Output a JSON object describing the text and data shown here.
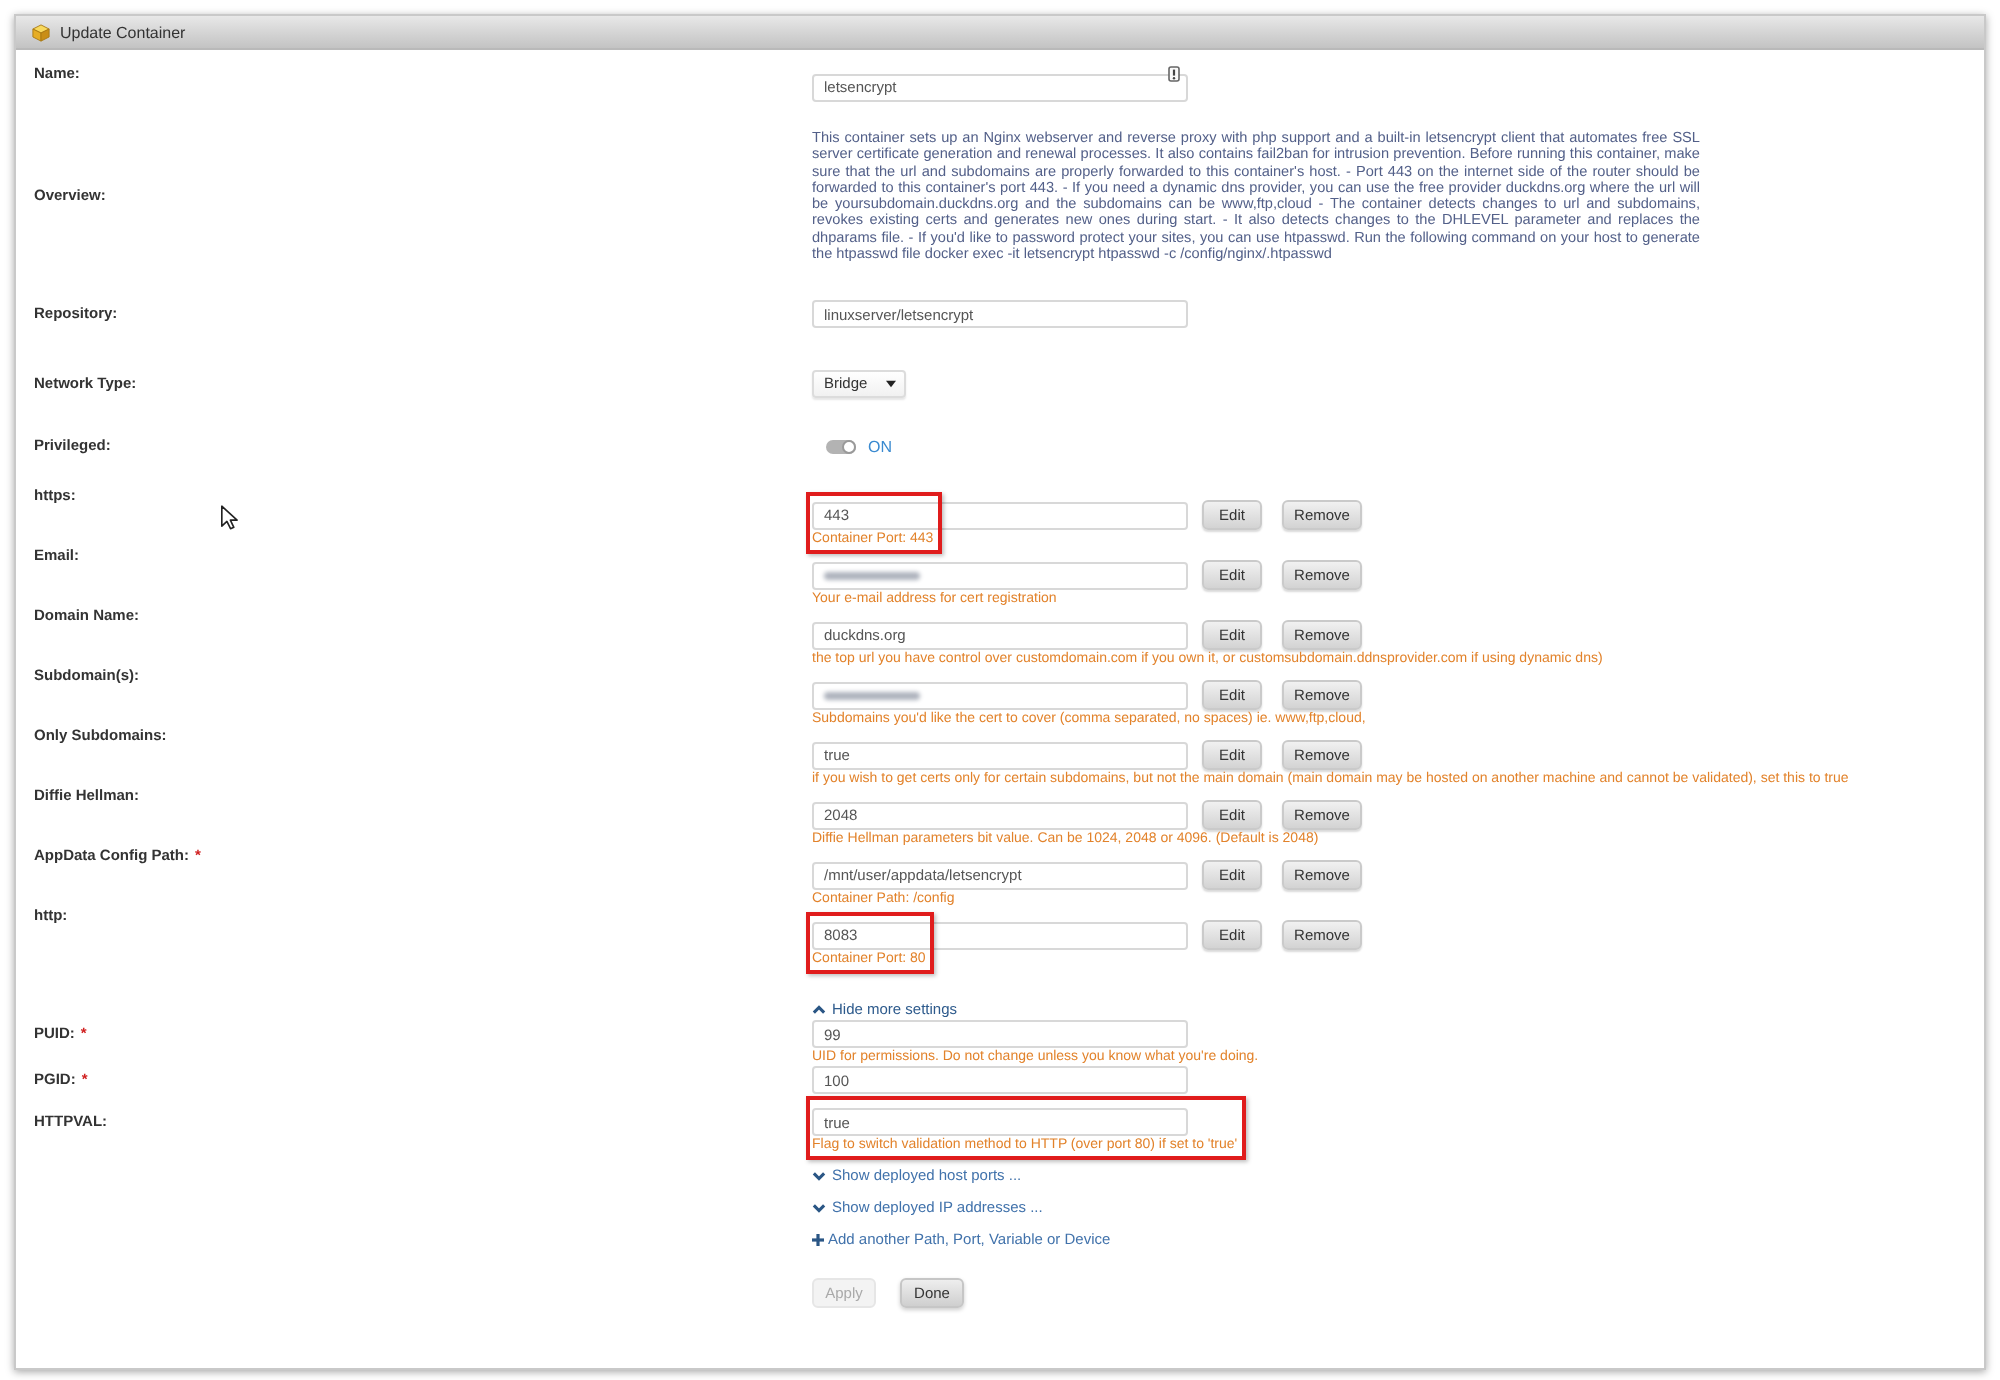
{
  "panel": {
    "title": "Update Container"
  },
  "fields": [
    {
      "kind": "badged",
      "label": "Name:",
      "value": "letsencrypt"
    },
    {
      "kind": "text",
      "label": "Overview:",
      "text": "This container sets up an Nginx webserver and reverse proxy with php support and a built-in letsencrypt client that automates free SSL server certificate generation and renewal processes. It also contains fail2ban for intrusion prevention. Before running this container, make sure that the url and subdomains are properly forwarded to this container's host. - Port 443 on the internet side of the router should be forwarded to this container's port 443. - If you need a dynamic dns provider, you can use the free provider duckdns.org where the url will be yoursubdomain.duckdns.org and the subdomains can be www,ftp,cloud - The container detects changes to url and subdomains, revokes existing certs and generates new ones during start. - It also detects changes to the DHLEVEL parameter and replaces the dhparams file. - If you'd like to password protect your sites, you can use htpasswd. Run the following command on your host to generate the htpasswd file docker exec -it letsencrypt htpasswd -c /config/nginx/.htpasswd"
    },
    {
      "kind": "field",
      "label": "Repository:",
      "value": "linuxserver/letsencrypt"
    },
    {
      "kind": "select",
      "label": "Network Type:",
      "value": "Bridge"
    },
    {
      "kind": "switch",
      "label": "Privileged:",
      "on": true,
      "state_label": "ON"
    },
    {
      "kind": "mapping",
      "label": "https:",
      "value": "443",
      "redacted": false,
      "description": "Container Port: 443",
      "highlighted": true,
      "buttons": [
        {
          "kind": "edit",
          "label": "Edit"
        },
        {
          "kind": "remove",
          "label": "Remove"
        }
      ]
    },
    {
      "kind": "mapping",
      "label": "Email:",
      "redacted": true,
      "description": "Your e-mail address for cert registration",
      "highlighted": false,
      "buttons": [
        {
          "kind": "edit",
          "label": "Edit"
        },
        {
          "kind": "remove",
          "label": "Remove"
        }
      ]
    },
    {
      "kind": "mapping",
      "label": "Domain Name:",
      "value": "duckdns.org",
      "redacted": false,
      "description": "the top url you have control over customdomain.com if you own it, or customsubdomain.ddnsprovider.com if using dynamic dns)",
      "highlighted": false,
      "buttons": [
        {
          "kind": "edit",
          "label": "Edit"
        },
        {
          "kind": "remove",
          "label": "Remove"
        }
      ]
    },
    {
      "kind": "mapping",
      "label": "Subdomain(s):",
      "redacted": true,
      "description": "Subdomains you'd like the cert to cover (comma separated, no spaces) ie. www,ftp,cloud,",
      "highlighted": false,
      "buttons": [
        {
          "kind": "edit",
          "label": "Edit"
        },
        {
          "kind": "remove",
          "label": "Remove"
        }
      ]
    },
    {
      "kind": "mapping",
      "label": "Only Subdomains:",
      "value": "true",
      "redacted": false,
      "description": "if you wish to get certs only for certain subdomains, but not the main domain (main domain may be hosted on another machine and cannot be validated), set this to true",
      "highlighted": false,
      "buttons": [
        {
          "kind": "edit",
          "label": "Edit"
        },
        {
          "kind": "remove",
          "label": "Remove"
        }
      ]
    },
    {
      "kind": "mapping",
      "label": "Diffie Hellman:",
      "value": "2048",
      "redacted": false,
      "description": "Diffie Hellman parameters bit value. Can be 1024, 2048 or 4096. (Default is 2048)",
      "highlighted": false,
      "buttons": [
        {
          "kind": "edit",
          "label": "Edit"
        },
        {
          "kind": "remove",
          "label": "Remove"
        }
      ]
    },
    {
      "kind": "mapping",
      "label": "AppData Config Path:",
      "required_mark": "*",
      "value": "/mnt/user/appdata/letsencrypt",
      "redacted": false,
      "description": "Container Path: /config",
      "highlighted": false,
      "buttons": [
        {
          "kind": "edit",
          "label": "Edit"
        },
        {
          "kind": "remove",
          "label": "Remove"
        }
      ]
    },
    {
      "kind": "mapping",
      "label": "http:",
      "value": "8083",
      "redacted": false,
      "description": "Container Port: 80",
      "highlighted": true,
      "buttons": [
        {
          "kind": "edit",
          "label": "Edit"
        },
        {
          "kind": "remove",
          "label": "Remove"
        }
      ]
    }
  ],
  "more_settings": {
    "label": "Hide more settings",
    "expanded": true
  },
  "advanced_fields": [
    {
      "kind": "variable",
      "label": "PUID:",
      "required_mark": "*",
      "value": "99",
      "description": "UID for permissions. Do not change unless you know what you're doing.",
      "highlighted": false
    },
    {
      "kind": "variable",
      "label": "PGID:",
      "required_mark": "*",
      "value": "100",
      "highlighted": false
    },
    {
      "kind": "variable",
      "label": "HTTPVAL:",
      "value": "true",
      "description": "Flag to switch validation method to HTTP (over port 80) if set to 'true'",
      "highlighted": true
    }
  ],
  "links": [
    {
      "kind": "expand",
      "label": "Show deployed host ports ...",
      "expanded": false
    },
    {
      "kind": "expand",
      "label": "Show deployed IP addresses ...",
      "expanded": false
    },
    {
      "kind": "add",
      "label": "Add another Path, Port, Variable or Device"
    }
  ],
  "actions": [
    {
      "label": "Apply",
      "disabled": true
    },
    {
      "label": "Done",
      "disabled": false
    }
  ]
}
